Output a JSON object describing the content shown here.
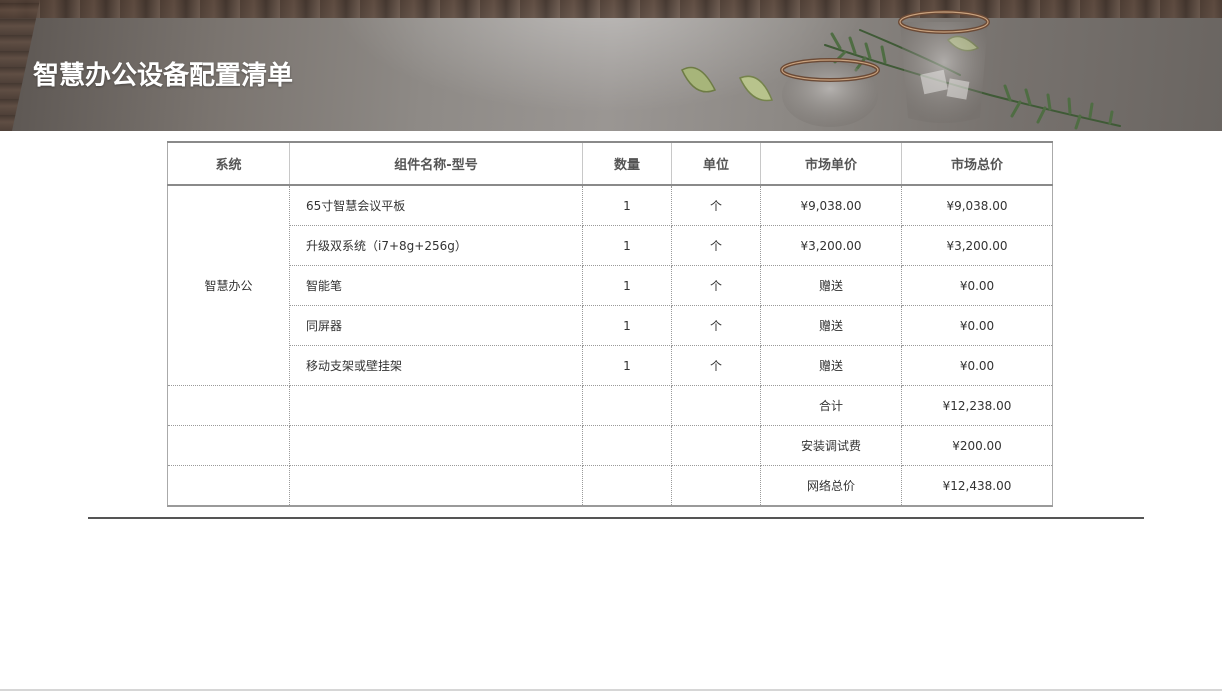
{
  "title": "智慧办公设备配置清单",
  "table": {
    "headers": [
      "系统",
      "组件名称-型号",
      "数量",
      "单位",
      "市场单价",
      "市场总价"
    ],
    "group_label": "智慧办公",
    "rows": [
      {
        "name": "65寸智慧会议平板",
        "qty": "1",
        "unit": "个",
        "unit_price": "¥9,038.00",
        "total": "¥9,038.00"
      },
      {
        "name": "升级双系统（i7+8g+256g）",
        "qty": "1",
        "unit": "个",
        "unit_price": "¥3,200.00",
        "total": "¥3,200.00"
      },
      {
        "name": "智能笔",
        "qty": "1",
        "unit": "个",
        "unit_price": "赠送",
        "total": "¥0.00"
      },
      {
        "name": "同屏器",
        "qty": "1",
        "unit": "个",
        "unit_price": "赠送",
        "total": "¥0.00"
      },
      {
        "name": "移动支架或壁挂架",
        "qty": "1",
        "unit": "个",
        "unit_price": "赠送",
        "total": "¥0.00"
      }
    ],
    "summary": [
      {
        "label": "合计",
        "value": "¥12,238.00"
      },
      {
        "label": "安装调试费",
        "value": "¥200.00"
      },
      {
        "label": "网络总价",
        "value": "¥12,438.00"
      }
    ]
  },
  "icons": {
    "banner_decor": "glasses-lime-rosemary-image"
  }
}
